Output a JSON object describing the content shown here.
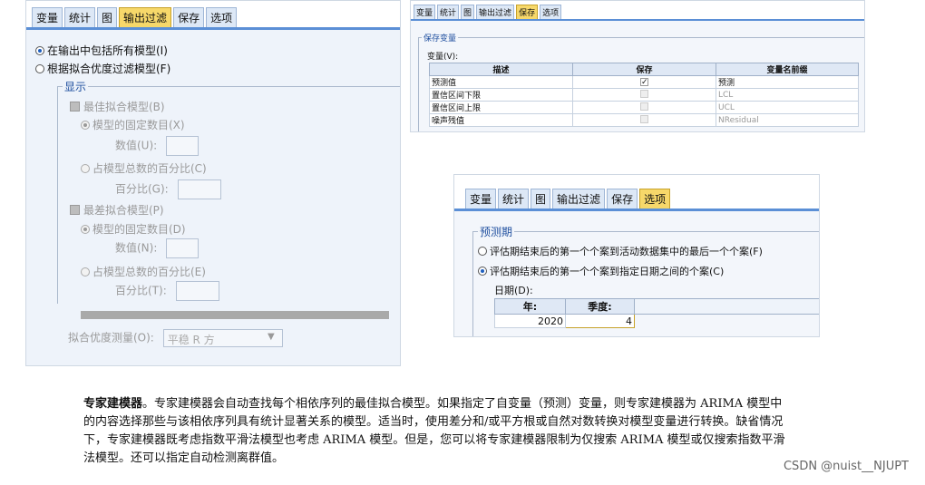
{
  "panel1": {
    "tabs": [
      "变量",
      "统计",
      "图",
      "输出过滤",
      "保存",
      "选项"
    ],
    "active_tab": "输出过滤",
    "radio_all": "在输出中包括所有模型(I)",
    "radio_filter": "根据拟合优度过滤模型(F)",
    "display_group": "显示",
    "best_check": "最佳拟合模型(B)",
    "best_fixed": "模型的固定数目(X)",
    "best_fixed_value_label": "数值(U):",
    "best_pct": "占模型总数的百分比(C)",
    "best_pct_label": "百分比(G):",
    "worst_check": "最差拟合模型(P)",
    "worst_fixed": "模型的固定数目(D)",
    "worst_fixed_value_label": "数值(N):",
    "worst_pct": "占模型总数的百分比(E)",
    "worst_pct_label": "百分比(T):",
    "gof_label": "拟合优度测量(O):",
    "gof_value": "平稳 R 方"
  },
  "panel2": {
    "tabs": [
      "变量",
      "统计",
      "图",
      "输出过滤",
      "保存",
      "选项"
    ],
    "active_tab": "保存",
    "group": "保存变量",
    "variables_label": "变量(V):",
    "columns": [
      "描述",
      "保存",
      "变量名前缀"
    ],
    "rows": [
      {
        "desc": "预测值",
        "save": true,
        "prefix": "预测"
      },
      {
        "desc": "置信区间下限",
        "save": false,
        "prefix": "LCL"
      },
      {
        "desc": "置信区间上限",
        "save": false,
        "prefix": "UCL"
      },
      {
        "desc": "噪声残值",
        "save": false,
        "prefix": "NResidual"
      }
    ]
  },
  "panel3": {
    "tabs": [
      "变量",
      "统计",
      "图",
      "输出过滤",
      "保存",
      "选项"
    ],
    "active_tab": "选项",
    "group": "预测期",
    "radio1": "评估期结束后的第一个个案到活动数据集中的最后一个个案(F)",
    "radio2": "评估期结束后的第一个个案到指定日期之间的个案(C)",
    "date_label": "日期(D):",
    "year_header": "年:",
    "season_header": "季度:",
    "year_value": "2020",
    "season_value": "4"
  },
  "paragraph": {
    "bold": "专家建模器",
    "text": "。专家建模器会自动查找每个相依序列的最佳拟合模型。如果指定了自变量（预测）变量，则专家建模器为 ARIMA 模型中的内容选择那些与该相依序列具有统计显著关系的模型。适当时，使用差分和/或平方根或自然对数转换对模型变量进行转换。缺省情况下，专家建模器既考虑指数平滑法模型也考虑 ARIMA 模型。但是，您可以将专家建模器限制为仅搜索 ARIMA 模型或仅搜索指数平滑法模型。还可以指定自动检测离群值。"
  },
  "watermark": "CSDN @nuist__NJUPT"
}
